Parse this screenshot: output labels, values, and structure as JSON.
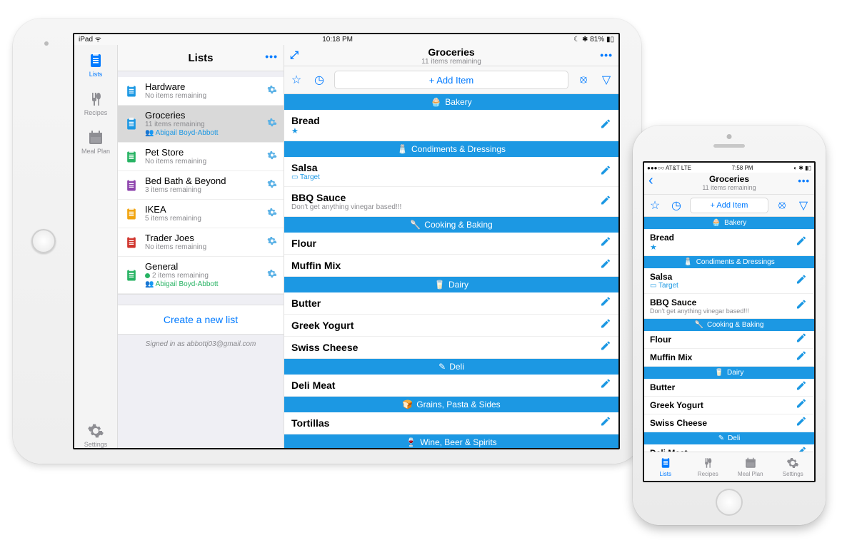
{
  "colors": {
    "accent": "#007aff",
    "section": "#1c98e3"
  },
  "ipad": {
    "status": {
      "left": "iPad ᯤ",
      "center": "10:18 PM",
      "right": "☾ ✱ 81% ▮▯"
    },
    "nav": {
      "tabs": [
        {
          "key": "lists",
          "label": "Lists",
          "active": true
        },
        {
          "key": "recipes",
          "label": "Recipes",
          "active": false
        },
        {
          "key": "mealplan",
          "label": "Meal Plan",
          "active": false
        }
      ],
      "settings_label": "Settings"
    },
    "lists_panel": {
      "title": "Lists",
      "create_label": "Create a new list",
      "signed_in": "Signed in as abbottj03@gmail.com",
      "rows": [
        {
          "name": "Hardware",
          "sub": "No items remaining",
          "color": "#1c98e3"
        },
        {
          "name": "Groceries",
          "sub": "11 items remaining",
          "shared": "Abigail Boyd-Abbott",
          "color": "#1c98e3",
          "selected": true
        },
        {
          "name": "Pet Store",
          "sub": "No items remaining",
          "color": "#27b363"
        },
        {
          "name": "Bed Bath & Beyond",
          "sub": "3 items remaining",
          "color": "#8e44ad"
        },
        {
          "name": "IKEA",
          "sub": "5 items remaining",
          "color": "#f1a40f"
        },
        {
          "name": "Trader Joes",
          "sub": "No items remaining",
          "color": "#d0342c"
        },
        {
          "name": "General",
          "sub": "2 items remaining",
          "shared": "Abigail Boyd-Abbott",
          "color": "#27b363",
          "dot": true
        }
      ]
    },
    "detail": {
      "title": "Groceries",
      "subtitle": "11 items remaining",
      "add_item_label": "+ Add Item",
      "sections": [
        {
          "icon": "🧁",
          "name": "Bakery",
          "items": [
            {
              "name": "Bread",
              "starred": true
            }
          ]
        },
        {
          "icon": "🧂",
          "name": "Condiments & Dressings",
          "items": [
            {
              "name": "Salsa",
              "store": "Target"
            },
            {
              "name": "BBQ Sauce",
              "note": "Don't get anything vinegar based!!!"
            }
          ]
        },
        {
          "icon": "🥄",
          "name": "Cooking & Baking",
          "items": [
            {
              "name": "Flour"
            },
            {
              "name": "Muffin Mix"
            }
          ]
        },
        {
          "icon": "🥛",
          "name": "Dairy",
          "items": [
            {
              "name": "Butter"
            },
            {
              "name": "Greek Yogurt"
            },
            {
              "name": "Swiss Cheese"
            }
          ]
        },
        {
          "icon": "✎",
          "name": "Deli",
          "items": [
            {
              "name": "Deli Meat"
            }
          ]
        },
        {
          "icon": "🍞",
          "name": "Grains, Pasta & Sides",
          "items": [
            {
              "name": "Tortillas"
            }
          ]
        },
        {
          "icon": "🍷",
          "name": "Wine, Beer & Spirits",
          "items": []
        }
      ]
    }
  },
  "iphone": {
    "status": {
      "left": "●●●○○ AT&T  LTE",
      "center": "7:58 PM",
      "right": "◐ ✱ ▮▯"
    },
    "detail": {
      "title": "Groceries",
      "subtitle": "11 items remaining",
      "add_item_label": "+ Add Item",
      "sections": [
        {
          "icon": "🧁",
          "name": "Bakery",
          "items": [
            {
              "name": "Bread",
              "starred": true
            }
          ]
        },
        {
          "icon": "🧂",
          "name": "Condiments & Dressings",
          "items": [
            {
              "name": "Salsa",
              "store": "Target"
            },
            {
              "name": "BBQ Sauce",
              "note": "Don't get anything vinegar based!!!"
            }
          ]
        },
        {
          "icon": "🥄",
          "name": "Cooking & Baking",
          "items": [
            {
              "name": "Flour"
            },
            {
              "name": "Muffin Mix"
            }
          ]
        },
        {
          "icon": "🥛",
          "name": "Dairy",
          "items": [
            {
              "name": "Butter"
            },
            {
              "name": "Greek Yogurt"
            },
            {
              "name": "Swiss Cheese"
            }
          ]
        },
        {
          "icon": "✎",
          "name": "Deli",
          "items": [
            {
              "name": "Deli Meat"
            }
          ]
        }
      ]
    },
    "tabbar": [
      {
        "key": "lists",
        "label": "Lists",
        "active": true
      },
      {
        "key": "recipes",
        "label": "Recipes",
        "active": false
      },
      {
        "key": "mealplan",
        "label": "Meal Plan",
        "active": false
      },
      {
        "key": "settings",
        "label": "Settings",
        "active": false
      }
    ]
  }
}
